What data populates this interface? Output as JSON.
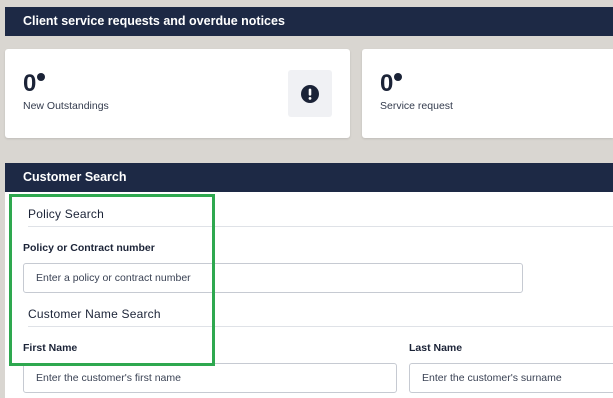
{
  "overdue": {
    "title": "Client service requests and overdue notices",
    "cards": [
      {
        "count": "0",
        "label": "New Outstandings",
        "icon": "exclamation-circle-icon"
      },
      {
        "count": "0",
        "label": "Service request"
      }
    ]
  },
  "customer_search": {
    "title": "Customer Search",
    "policy_section": {
      "title": "Policy Search",
      "field_label": "Policy or Contract number",
      "placeholder": "Enter a policy or contract number"
    },
    "name_section": {
      "title": "Customer Name Search",
      "first_name_label": "First Name",
      "first_name_placeholder": "Enter the customer's first name",
      "last_name_label": "Last Name",
      "last_name_placeholder": "Enter the customer's surname"
    }
  },
  "colors": {
    "header_navy": "#1d2945",
    "highlight_green": "#2ea84f",
    "page_background": "#d9d6d1"
  }
}
